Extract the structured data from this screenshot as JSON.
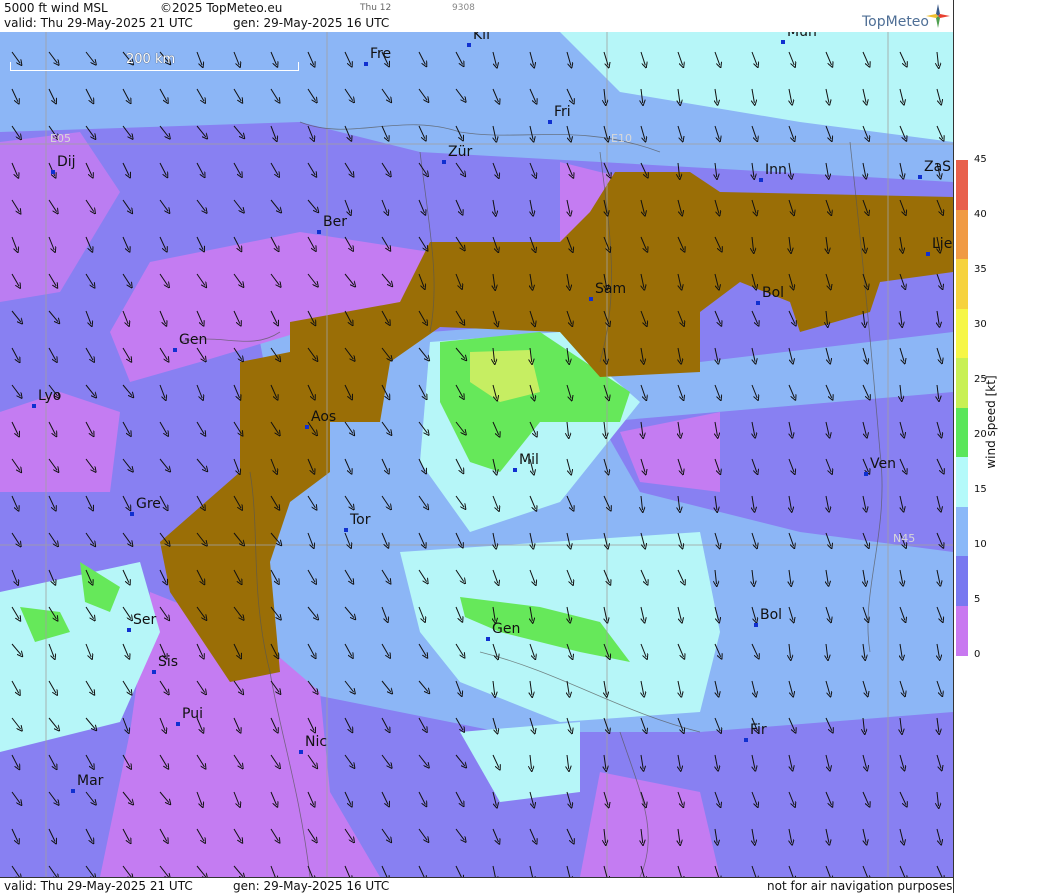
{
  "header": {
    "product": "5000 ft wind MSL",
    "copyright": "©2025 TopMeteo.eu",
    "small_day": "Thu 12",
    "small_code": "9308",
    "valid": "valid:  Thu   29-May-2025  21 UTC",
    "gen": "gen: 29-May-2025 16 UTC",
    "logo": "TopMeteo"
  },
  "footer": {
    "valid": "valid:  Thu   29-May-2025   21 UTC",
    "gen": "gen: 29-May-2025 16 UTC",
    "note": "not for air navigation purposes"
  },
  "scale_bar": {
    "label": "200 km"
  },
  "grid_labels": {
    "e05": "E05",
    "e10": "E10",
    "n45": "N45"
  },
  "cities": [
    {
      "name": "Kli"
    },
    {
      "name": "Mun"
    },
    {
      "name": "Fre"
    },
    {
      "name": "Fri"
    },
    {
      "name": "Dij"
    },
    {
      "name": "Zür"
    },
    {
      "name": "Inn"
    },
    {
      "name": "ZaS"
    },
    {
      "name": "Ber"
    },
    {
      "name": "Lie"
    },
    {
      "name": "Sam"
    },
    {
      "name": "Bol"
    },
    {
      "name": "Gen"
    },
    {
      "name": "Lyo"
    },
    {
      "name": "Aos"
    },
    {
      "name": "Mil"
    },
    {
      "name": "Ven"
    },
    {
      "name": "Gre"
    },
    {
      "name": "Tor"
    },
    {
      "name": "Ser"
    },
    {
      "name": "Gen"
    },
    {
      "name": "Bol"
    },
    {
      "name": "Sis"
    },
    {
      "name": "Pui"
    },
    {
      "name": "Nic"
    },
    {
      "name": "Fir"
    },
    {
      "name": "Mar"
    }
  ],
  "legend": {
    "title": "wind speed [kt]",
    "ticks": [
      "45",
      "40",
      "35",
      "30",
      "25",
      "20",
      "15",
      "10",
      "5",
      "0"
    ],
    "colors": [
      "#e8604c",
      "#f09a44",
      "#f6d23e",
      "#f6f646",
      "#c8f054",
      "#5ae65a",
      "#b4fafa",
      "#8ab8f8",
      "#7878f0",
      "#c878f0"
    ]
  },
  "colors": {
    "terrain": "#9a6e06",
    "purple": "#c47cf2",
    "violet": "#8880f2",
    "lightblue": "#8cb6f6",
    "cyan": "#b6f6f8",
    "green": "#66e85a",
    "yellowgreen": "#c6ee62"
  }
}
